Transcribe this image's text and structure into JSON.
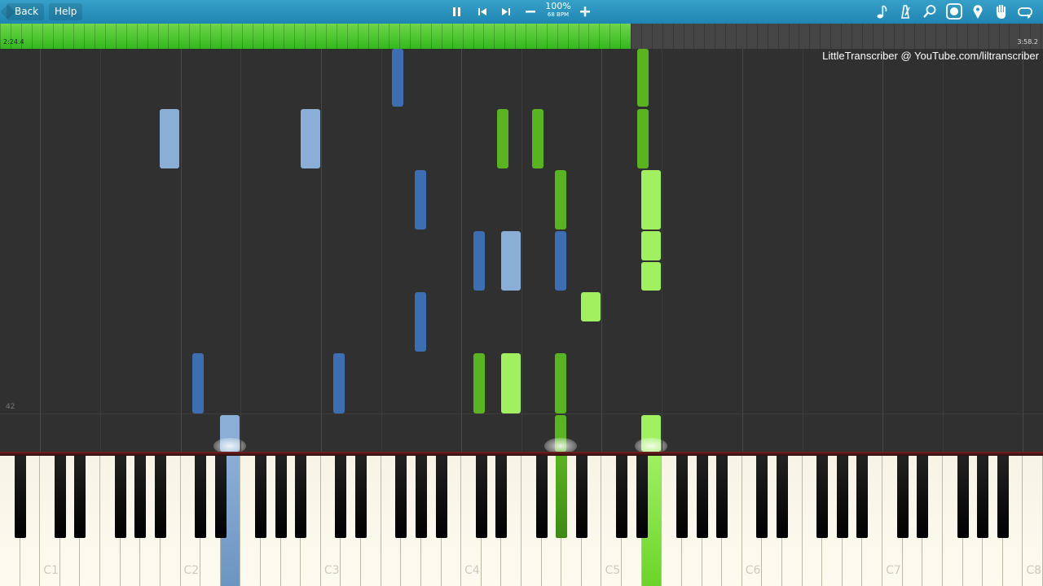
{
  "toolbar": {
    "back_label": "Back",
    "help_label": "Help",
    "speed_percent": "100%",
    "speed_bpm": "68 BPM",
    "icons": {
      "pause": "pause-icon",
      "prev": "skip-back-icon",
      "next": "skip-forward-icon",
      "slower": "minus-icon",
      "faster": "plus-icon",
      "note": "music-note-icon",
      "metronome": "metronome-icon",
      "zoom": "magnifier-icon",
      "labels": "note-label-icon",
      "marker": "map-pin-icon",
      "hand": "hand-icon",
      "loop": "loop-icon"
    }
  },
  "progress": {
    "elapsed": "2:24.4",
    "total": "3:58.2",
    "fraction": 0.605
  },
  "watermark": "LittleTranscriber @ YouTube.com/liltranscriber",
  "measure_number": "42",
  "keyboard": {
    "octave_labels": [
      "C1",
      "C2",
      "C3",
      "C4",
      "C5",
      "C6",
      "C7",
      "C8"
    ]
  },
  "colors": {
    "left_hand_light": "#8aaed6",
    "left_hand_dark": "#3e6eb2",
    "right_hand_light": "#a0f060",
    "right_hand_dark": "#5ab320",
    "toolbar": "#2a93bf",
    "progress": "#4ac530"
  }
}
